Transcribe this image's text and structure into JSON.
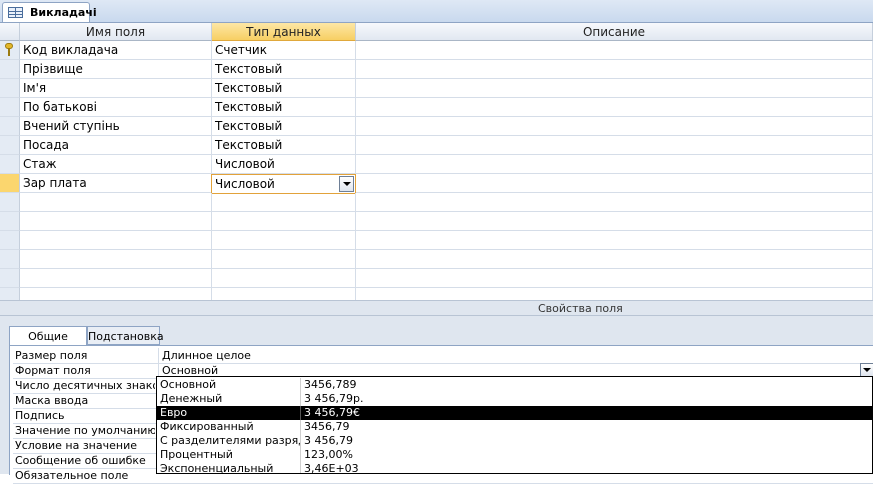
{
  "tab": {
    "title": "Викладачі"
  },
  "grid": {
    "headers": {
      "name": "Имя поля",
      "type": "Тип данных",
      "description": "Описание"
    },
    "rows": [
      {
        "name": "Код викладача",
        "type": "Счетчик",
        "primary_key": true
      },
      {
        "name": "Прізвище",
        "type": "Текстовый"
      },
      {
        "name": "Ім'я",
        "type": "Текстовый"
      },
      {
        "name": "По батькові",
        "type": "Текстовый"
      },
      {
        "name": "Вчений ступінь",
        "type": "Текстовый"
      },
      {
        "name": "Посада",
        "type": "Текстовый"
      },
      {
        "name": "Стаж",
        "type": "Числовой"
      },
      {
        "name": "Зар плата",
        "type": "Числовой",
        "current": true
      }
    ]
  },
  "properties": {
    "caption": "Свойства поля",
    "tabs": {
      "general": "Общие",
      "lookup": "Подстановка"
    },
    "rows": [
      {
        "label": "Размер поля",
        "value": "Длинное целое"
      },
      {
        "label": "Формат поля",
        "value": "Основной"
      },
      {
        "label": "Число десятичных знаков",
        "value": ""
      },
      {
        "label": "Маска ввода",
        "value": ""
      },
      {
        "label": "Подпись",
        "value": ""
      },
      {
        "label": "Значение по умолчанию",
        "value": ""
      },
      {
        "label": "Условие на значение",
        "value": ""
      },
      {
        "label": "Сообщение об ошибке",
        "value": ""
      },
      {
        "label": "Обязательное поле",
        "value": ""
      }
    ]
  },
  "format_dropdown": {
    "options": [
      {
        "name": "Основной",
        "sample": "3456,789"
      },
      {
        "name": "Денежный",
        "sample": "3 456,79р."
      },
      {
        "name": "Евро",
        "sample": "3 456,79€",
        "selected": true
      },
      {
        "name": "Фиксированный",
        "sample": "3456,79"
      },
      {
        "name": "С разделителями разрядов",
        "sample": "3 456,79"
      },
      {
        "name": "Процентный",
        "sample": "123,00%"
      },
      {
        "name": "Экспоненциальный",
        "sample": "3,46E+03"
      }
    ]
  },
  "colors": {
    "accent": "#fbd66e",
    "selection": "#000000"
  }
}
